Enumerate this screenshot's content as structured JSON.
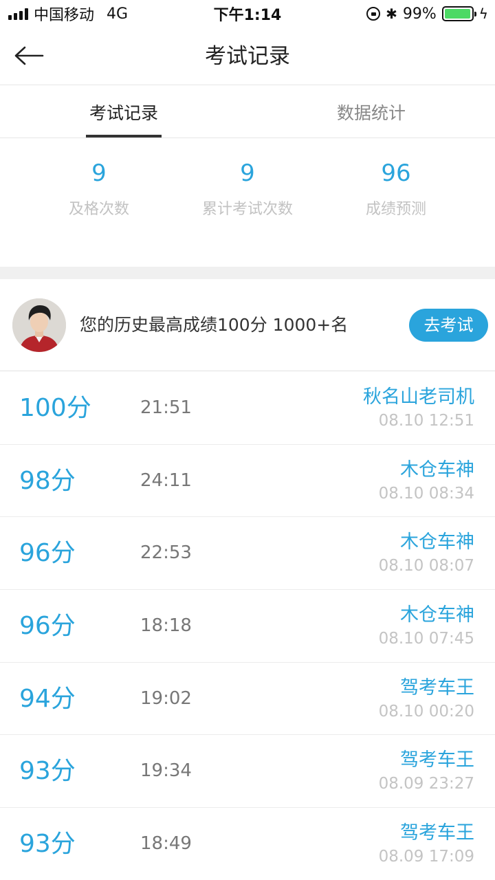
{
  "status_bar": {
    "carrier": "中国移动",
    "network": "4G",
    "time": "下午1:14",
    "battery_percent": "99%",
    "battery_level": 0.99,
    "icons": [
      "signal-icon",
      "orientation-lock-icon",
      "bluetooth-icon",
      "battery-icon",
      "charging-icon"
    ]
  },
  "header": {
    "title": "考试记录",
    "back_icon": "arrow-left-icon"
  },
  "tabs": [
    {
      "label": "考试记录",
      "active": true
    },
    {
      "label": "数据统计",
      "active": false
    }
  ],
  "summary": [
    {
      "value": "9",
      "label": "及格次数"
    },
    {
      "value": "9",
      "label": "累计考试次数"
    },
    {
      "value": "96",
      "label": "成绩预测"
    }
  ],
  "best": {
    "text": "您的历史最高成绩100分 1000+名",
    "button_label": "去考试"
  },
  "records": [
    {
      "score": "100分",
      "duration": "21:51",
      "name": "秋名山老司机",
      "date": "08.10 12:51"
    },
    {
      "score": "98分",
      "duration": "24:11",
      "name": "木仓车神",
      "date": "08.10 08:34"
    },
    {
      "score": "96分",
      "duration": "22:53",
      "name": "木仓车神",
      "date": "08.10 08:07"
    },
    {
      "score": "96分",
      "duration": "18:18",
      "name": "木仓车神",
      "date": "08.10 07:45"
    },
    {
      "score": "94分",
      "duration": "19:02",
      "name": "驾考车王",
      "date": "08.10 00:20"
    },
    {
      "score": "93分",
      "duration": "19:34",
      "name": "驾考车王",
      "date": "08.09 23:27"
    },
    {
      "score": "93分",
      "duration": "18:49",
      "name": "驾考车王",
      "date": "08.09 17:09"
    }
  ],
  "colors": {
    "accent": "#2aa4dc",
    "muted_text": "#c2c2c2",
    "divider": "#e6e6e6",
    "battery_green": "#4cd964"
  }
}
